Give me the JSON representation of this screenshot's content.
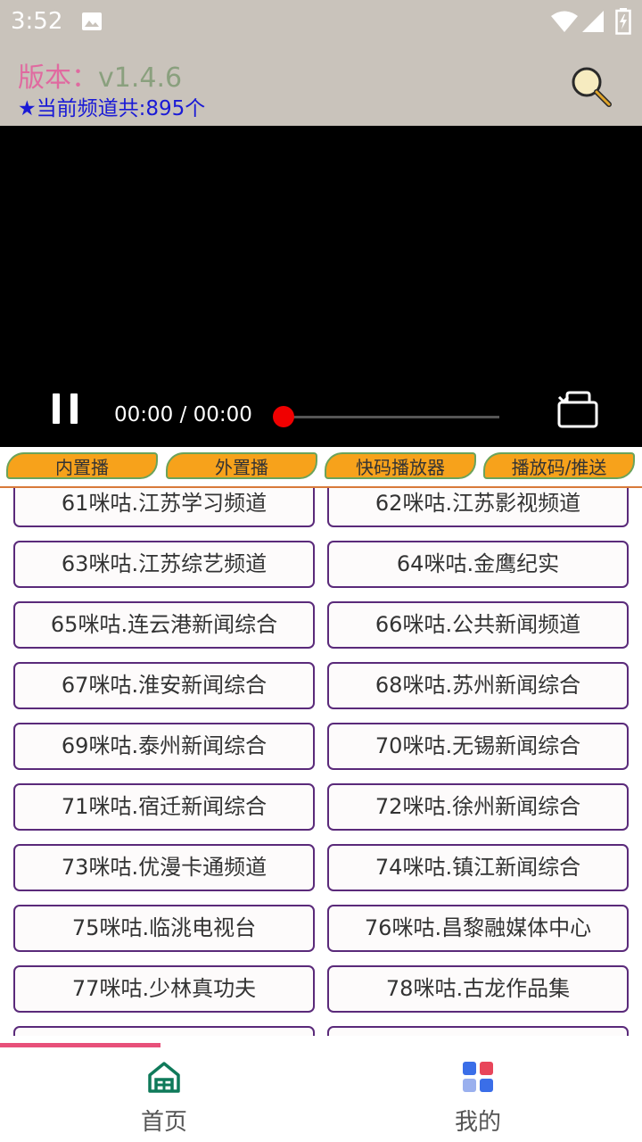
{
  "status_bar": {
    "time": "3:52"
  },
  "header": {
    "version_label": "版本：",
    "version_value": "v1.4.6",
    "channel_count": "★当前频道共:895个"
  },
  "player": {
    "time_display": "00:00 / 00:00",
    "progress": 0
  },
  "modes": [
    "内置播",
    "外置播",
    "快码播放器",
    "播放码/推送"
  ],
  "channels": [
    "61咪咕.江苏学习频道",
    "62咪咕.江苏影视频道",
    "63咪咕.江苏综艺频道",
    "64咪咕.金鹰纪实",
    "65咪咕.连云港新闻综合",
    "66咪咕.公共新闻频道",
    "67咪咕.淮安新闻综合",
    "68咪咕.苏州新闻综合",
    "69咪咕.泰州新闻综合",
    "70咪咕.无锡新闻综合",
    "71咪咕.宿迁新闻综合",
    "72咪咕.徐州新闻综合",
    "73咪咕.优漫卡通频道",
    "74咪咕.镇江新闻综合",
    "75咪咕.临洮电视台",
    "76咪咕.昌黎融媒体中心",
    "77咪咕.少林真功夫",
    "78咪咕.古龙作品集"
  ],
  "nav": {
    "home_label": "首页",
    "mine_label": "我的"
  },
  "colors": {
    "accent": "#e8507a",
    "mode_button": "#f7a21b",
    "channel_border": "#5a2a7a",
    "header_bg": "#c9c3bb"
  }
}
